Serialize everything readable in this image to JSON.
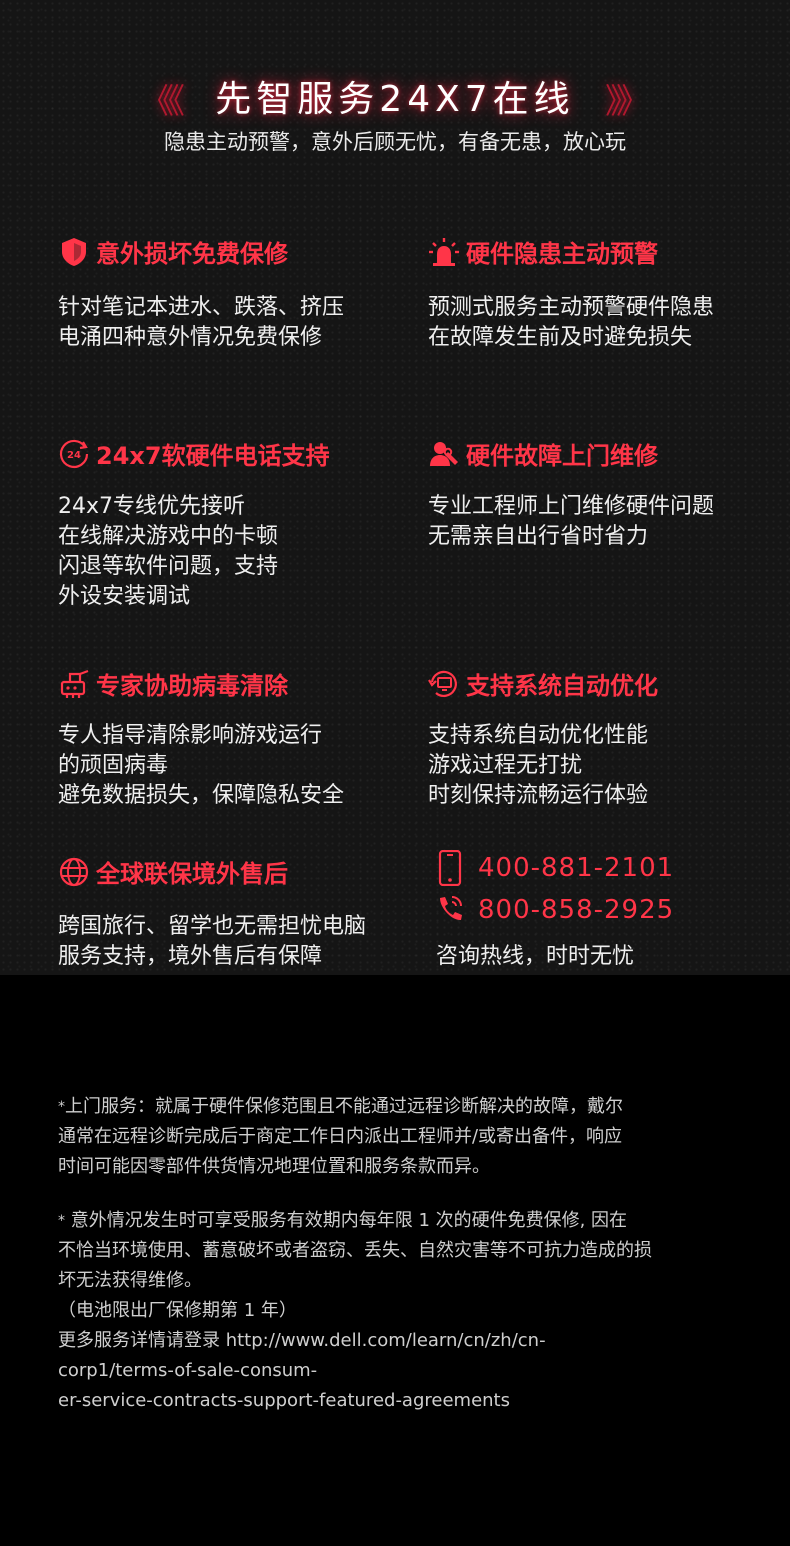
{
  "header": {
    "chev_left": "《《",
    "chev_right": "》》",
    "title": "先智服务24X7在线",
    "subtitle": "隐患主动预警，意外后顾无忧，有备无患，放心玩"
  },
  "features": [
    {
      "icon": "shield-icon",
      "title": "意外损坏免费保修",
      "lines": [
        "针对笔记本进水、跌落、挤压",
        "电涌四种意外情况免费保修"
      ]
    },
    {
      "icon": "alarm-icon",
      "title": "硬件隐患主动预警",
      "lines": [
        "预测式服务主动预警硬件隐患",
        "在故障发生前及时避免损失"
      ]
    },
    {
      "icon": "clock-24-icon",
      "title": "24x7软硬件电话支持",
      "lines": [
        "24x7专线优先接听",
        "在线解决游戏中的卡顿",
        "闪退等软件问题，支持",
        "外设安装调试"
      ]
    },
    {
      "icon": "technician-icon",
      "title": "硬件故障上门维修",
      "lines": [
        "专业工程师上门维修硬件问题",
        "无需亲自出行省时省力"
      ]
    },
    {
      "icon": "virus-clean-icon",
      "title": "专家协助病毒清除",
      "lines": [
        "专人指导清除影响游戏运行",
        "的顽固病毒",
        "避免数据损失，保障隐私安全"
      ]
    },
    {
      "icon": "system-optimize-icon",
      "title": "支持系统自动优化",
      "lines": [
        "支持系统自动优化性能",
        "游戏过程无打扰",
        "时刻保持流畅运行体验"
      ]
    },
    {
      "icon": "globe-icon",
      "title": "全球联保境外售后",
      "lines": [
        "跨国旅行、留学也无需担忧电脑",
        "服务支持，境外售后有保障"
      ]
    }
  ],
  "hotline": {
    "phone1": "400-881-2101",
    "phone2": "800-858-2925",
    "label": "咨询热线，时时无忧"
  },
  "footnotes": {
    "note1_star": "*",
    "note1": [
      "上门服务：就属于硬件保修范围且不能通过远程诊断解决的故障，戴尔",
      "通常在远程诊断完成后于商定工作日内派出工程师并/或寄出备件，响应",
      "时间可能因零部件供货情况地理位置和服务条款而异。"
    ],
    "note2_star": "*",
    "note2": [
      " 意外情况发生时可享受服务有效期内每年限 1 次的硬件免费保修, 因在",
      "不恰当环境使用、蓄意破坏或者盗窃、丢失、自然灾害等不可抗力造成的损",
      "坏无法获得维修。",
      "（电池限出厂保修期第 1 年）",
      " 更多服务详情请登录 http://www.dell.com/learn/cn/zh/cn-",
      "corp1/terms-of-sale-consum-",
      "er-service-contracts-support-featured-agreements"
    ]
  },
  "colors": {
    "accent": "#ff3548",
    "background": "#151515",
    "footer_background": "#000000"
  }
}
